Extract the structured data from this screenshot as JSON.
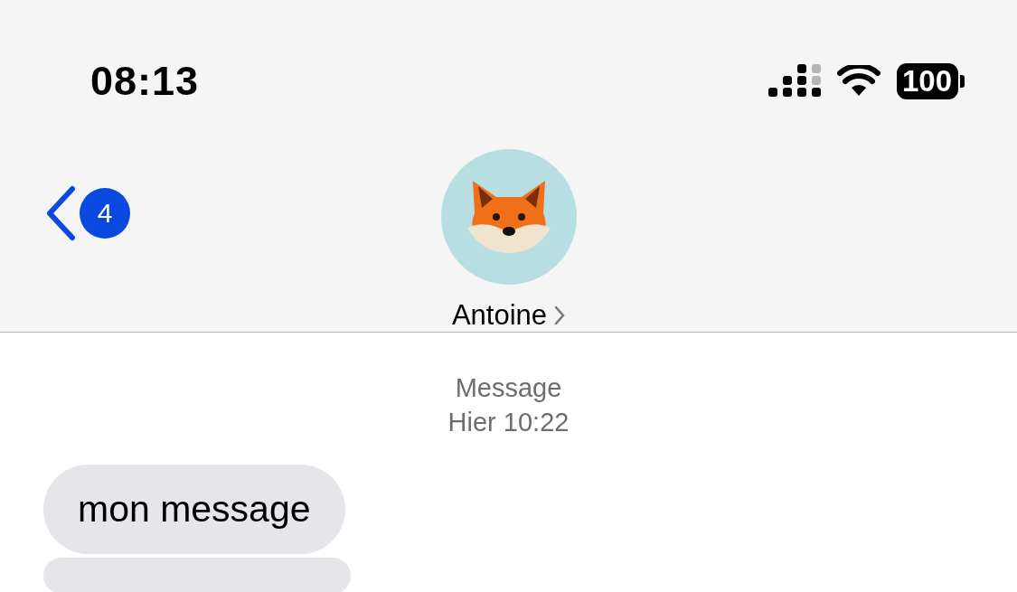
{
  "status_bar": {
    "time": "08:13",
    "battery": "100"
  },
  "nav": {
    "back_badge": "4",
    "contact_name": "Antoine"
  },
  "thread": {
    "service_label": "Message",
    "timestamp": "Hier 10:22",
    "messages": [
      {
        "kind": "received",
        "text": "mon message"
      },
      {
        "kind": "received_cut"
      }
    ]
  }
}
